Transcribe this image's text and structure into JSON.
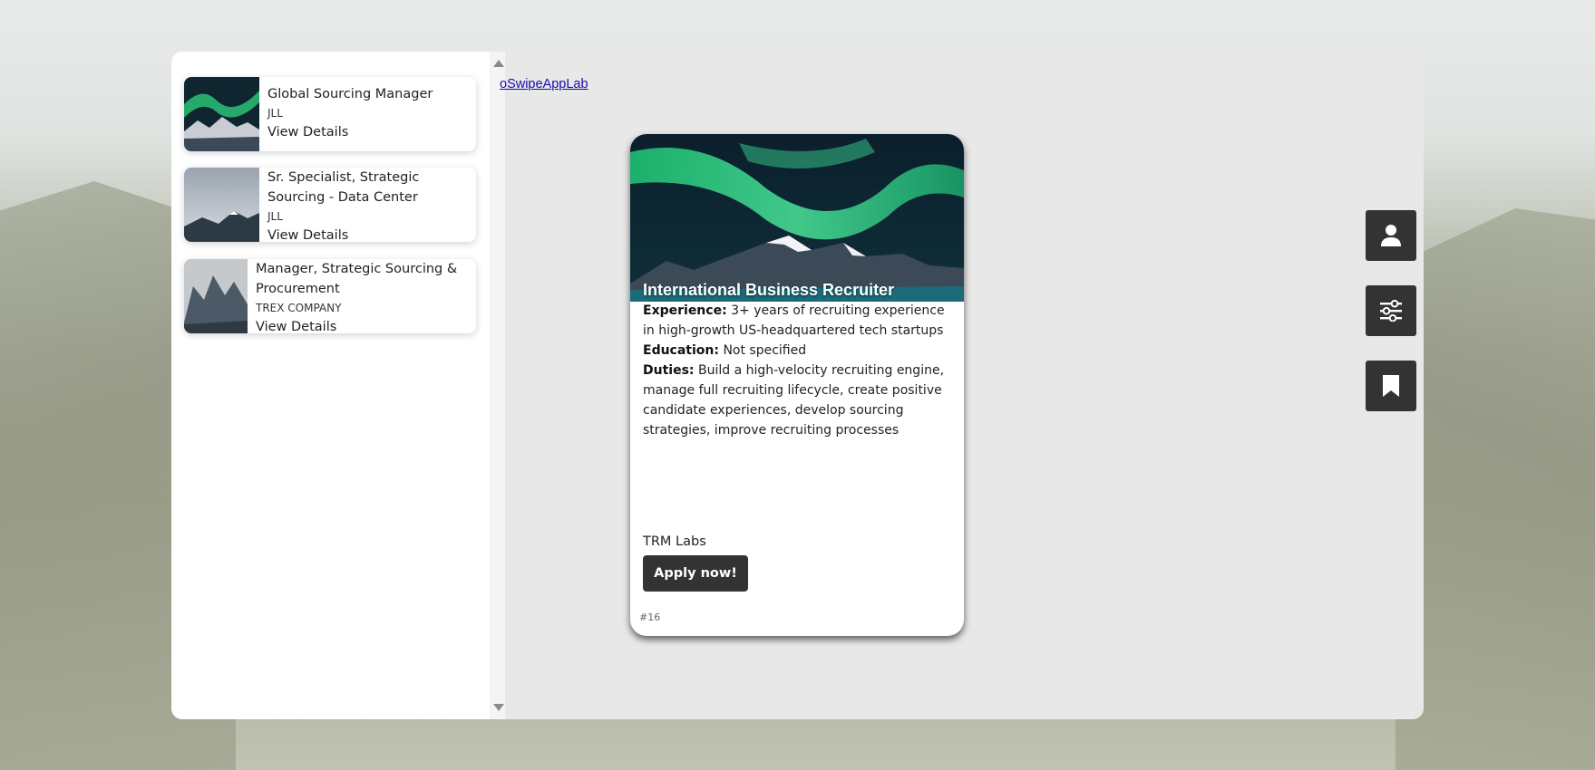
{
  "header": {
    "link_text": "oSwipeAppLab"
  },
  "sidebar": {
    "jobs": [
      {
        "title": "Global Sourcing Manager",
        "company": "JLL",
        "link": "View Details",
        "thumb_icon": "aurora-thumbnail"
      },
      {
        "title": "Sr. Specialist, Strategic Sourcing - Data Center",
        "company": "JLL",
        "link": "View Details",
        "thumb_icon": "misty-mountain-thumbnail"
      },
      {
        "title": "Manager, Strategic Sourcing & Procurement",
        "company": "TREX COMPANY",
        "link": "View Details",
        "thumb_icon": "rocky-peaks-thumbnail"
      }
    ]
  },
  "card": {
    "title": "International Business Recruiter",
    "experience_label": "Experience:",
    "experience": "3+ years of recruiting experience in high-growth US-headquartered tech startups",
    "education_label": "Education:",
    "education": "Not specified",
    "duties_label": "Duties:",
    "duties": "Build a high-velocity recruiting engine, manage full recruiting lifecycle, create positive candidate experiences, develop sourcing strategies, improve recruiting processes",
    "company": "TRM Labs",
    "apply_label": "Apply now!",
    "id_label": "#16"
  },
  "side_buttons": [
    {
      "icon": "user-icon"
    },
    {
      "icon": "sliders-icon"
    },
    {
      "icon": "bookmark-icon"
    }
  ],
  "colors": {
    "button_bg": "#333333",
    "panel_bg": "#e8e8e8",
    "link": "#1a0dab"
  }
}
